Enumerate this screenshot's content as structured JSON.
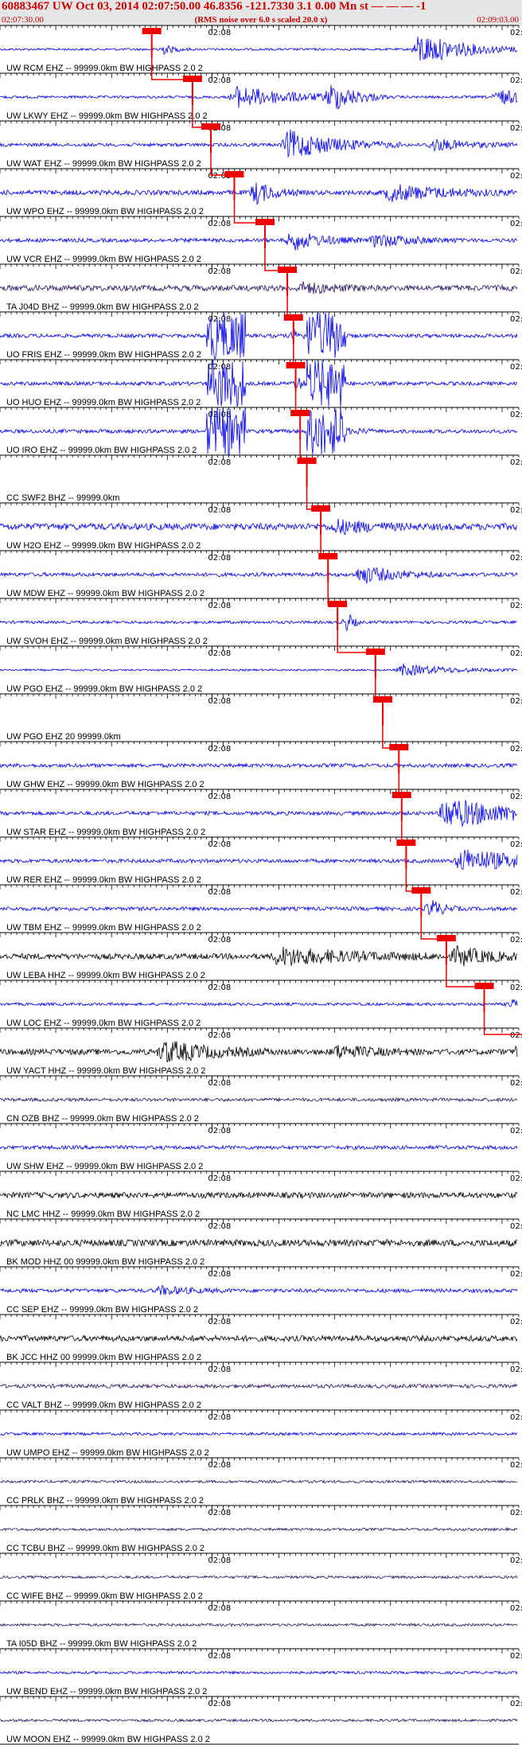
{
  "header": {
    "title": "60883467 UW Oct 03, 2014 02:07:50.00   46.8356 -121.7330  3.1 0.00 Mn st — — —  -1",
    "start_time": "02:07:30.00",
    "note": "(RMS noise over 6.0 s scaled 20.0 x)",
    "end_time": "02:09:03.00"
  },
  "chart_data": {
    "type": "line",
    "title": "60883467 UW Oct 03, 2014 02:07:50.00 46.8356 -121.7330 3.1 0.00 Mn",
    "x_start": "02:07:30.00",
    "x_end": "02:09:03.00",
    "minute_mark": "02:08",
    "minute_mark_end": "02:",
    "colors": {
      "blue": "#0000ee",
      "black": "#000000",
      "purple": "#2a1460",
      "pick": "#ee0000"
    },
    "series": [
      {
        "name": "UW RCM EHZ -- 99999.0km BW  HIGHPASS  2.0  2",
        "color": "blue",
        "pick_s": 27.2,
        "env": [
          [
            48,
            8,
            1.6
          ],
          [
            98,
            3,
            1.0
          ],
          [
            2,
            2,
            0.5
          ]
        ],
        "base": 0.12
      },
      {
        "name": "UW LKWY EHZ -- 99999.0km BW  HIGHPASS  2.0  2",
        "color": "blue",
        "pick_s": 34.5,
        "env": [
          [
            8,
            10,
            1.1
          ],
          [
            25,
            4,
            1.3
          ],
          [
            55,
            8,
            0.7
          ]
        ],
        "base": 0.14
      },
      {
        "name": "UW WAT EHZ -- 99999.0km BW  HIGHPASS  2.0  2",
        "color": "blue",
        "pick_s": 37.8,
        "env": [
          [
            14,
            8,
            1.5
          ],
          [
            40,
            6,
            0.6
          ]
        ],
        "base": 0.18
      },
      {
        "name": "UW WPO EHZ -- 99999.0km BW  HIGHPASS  2.0  2",
        "color": "blue",
        "pick_s": 42.0,
        "env": [
          [
            4,
            3,
            1.1
          ],
          [
            28,
            10,
            0.8
          ],
          [
            55,
            10,
            0.9
          ]
        ],
        "base": 0.25
      },
      {
        "name": "UW VCR EHZ -- 99999.0km BW  HIGHPASS  2.0  2",
        "color": "blue",
        "pick_s": 47.5,
        "env": [
          [
            5,
            5,
            1.0
          ],
          [
            20,
            6,
            0.7
          ]
        ],
        "base": 0.2
      },
      {
        "name": "TA J04D BHZ -- 99999.0km BW  HIGHPASS  2.0  2",
        "color": "purple",
        "pick_s": 51.5,
        "env": [
          [
            88,
            3,
            0.9
          ],
          [
            3,
            5,
            0.5
          ]
        ],
        "base": 0.3
      },
      {
        "name": "UO FRIS EHZ -- 99999.0km BW  HIGHPASS  2.0  2",
        "color": "blue",
        "pick_s": 52.6,
        "env": [
          [
            0.5,
            1,
            0.6
          ]
        ],
        "base": 0.2,
        "clip": [
          [
            37,
            44
          ],
          [
            55,
            62
          ]
        ]
      },
      {
        "name": "UO HUO EHZ -- 99999.0km BW  HIGHPASS  2.0  2",
        "color": "blue",
        "pick_s": 53.0,
        "env": [
          [
            0.5,
            1,
            0.6
          ]
        ],
        "base": 0.2,
        "clip": [
          [
            37,
            44
          ],
          [
            55,
            62
          ]
        ]
      },
      {
        "name": "UO IRO EHZ -- 99999.0km BW  HIGHPASS  2.0  2",
        "color": "blue",
        "pick_s": 53.8,
        "env": [
          [
            3,
            4,
            0.8
          ]
        ],
        "base": 0.2,
        "clip": [
          [
            37,
            44
          ],
          [
            55,
            62
          ]
        ]
      },
      {
        "name": "CC SWF2 BHZ -- 99999.0km",
        "color": "blue",
        "pick_s": 55.0,
        "env": [],
        "base": 0.0
      },
      {
        "name": "UW H2O EHZ -- 99999.0km BW  HIGHPASS  2.0  2",
        "color": "blue",
        "pick_s": 57.5,
        "env": [
          [
            3,
            6,
            0.6
          ]
        ],
        "base": 0.35
      },
      {
        "name": "UW MDW EHZ -- 99999.0km BW  HIGHPASS  2.0  2",
        "color": "blue",
        "pick_s": 58.8,
        "env": [
          [
            6,
            6,
            0.9
          ]
        ],
        "base": 0.2
      },
      {
        "name": "UW SVOH EHZ -- 99999.0km BW  HIGHPASS  2.0  2",
        "color": "blue",
        "pick_s": 60.5,
        "env": [
          [
            2,
            1,
            0.9
          ],
          [
            60,
            1,
            0.6
          ]
        ],
        "base": 0.15
      },
      {
        "name": "UW PGO EHZ -- 99999.0km BW  HIGHPASS  2.0  2",
        "color": "blue",
        "pick_s": 67.3,
        "env": [
          [
            5,
            8,
            0.6
          ]
        ],
        "base": 0.1
      },
      {
        "name": "UW PGO EHZ 20 99999.0km",
        "color": "blue",
        "pick_s": 68.6,
        "env": [],
        "base": 0.0
      },
      {
        "name": "UW GHW EHZ -- 99999.0km BW  HIGHPASS  2.0  2",
        "color": "blue",
        "pick_s": 71.5,
        "env": [
          [
            44,
            2,
            0.9
          ]
        ],
        "base": 0.2
      },
      {
        "name": "UW STAR EHZ -- 99999.0km BW  HIGHPASS  2.0  2",
        "color": "blue",
        "pick_s": 72.0,
        "env": [
          [
            8,
            12,
            1.6
          ]
        ],
        "base": 0.2
      },
      {
        "name": "UW RER EHZ -- 99999.0km BW  HIGHPASS  2.0  2",
        "color": "blue",
        "pick_s": 72.8,
        "env": [
          [
            10,
            12,
            1.2
          ]
        ],
        "base": 0.2
      },
      {
        "name": "UW TBM EHZ -- 99999.0km BW  HIGHPASS  2.0  2",
        "color": "blue",
        "pick_s": 75.5,
        "env": [
          [
            2,
            2,
            0.9
          ]
        ],
        "base": 0.2
      },
      {
        "name": "UW LEBA HHZ -- 99999.0km BW  HIGHPASS  2.0  2",
        "color": "black",
        "pick_s": 80.0,
        "env": [
          [
            -30,
            12,
            0.9
          ],
          [
            2,
            6,
            0.9
          ],
          [
            22,
            8,
            1.5
          ]
        ],
        "base": 0.3
      },
      {
        "name": "UW LOC EHZ -- 99999.0km BW  HIGHPASS  2.0  2",
        "color": "blue",
        "pick_s": 86.8,
        "env": [
          [
            5,
            5,
            0.4
          ]
        ],
        "base": 0.15
      },
      {
        "name": "UW YACT HHZ -- 99999.0km BW  HIGHPASS  2.0  2",
        "color": "black",
        "pick_s": 95.5,
        "env": [
          [
            -66,
            8,
            1.1
          ],
          [
            -35,
            6,
            0.6
          ],
          [
            -2,
            5,
            1.0
          ],
          [
            40,
            3,
            0.6
          ]
        ],
        "base": 0.3
      },
      {
        "name": "CN OZB BHZ -- 99999.0km BW  HIGHPASS  2.0  2",
        "color": "purple",
        "pick_s": 100.5,
        "env": [],
        "base": 0.18
      },
      {
        "name": "UW SHW EHZ -- 99999.0km BW  HIGHPASS  2.0  2",
        "color": "blue",
        "pick_s": 106.5,
        "env": [
          [
            4,
            6,
            0.7
          ]
        ],
        "base": 0.2
      },
      {
        "name": "NC LMC HHZ -- 99999.0km BW  HIGHPASS  2.0  2",
        "color": "black",
        "pick_s": 110.0,
        "env": [
          [
            -5,
            12,
            0.7
          ],
          [
            3,
            3,
            1.0
          ],
          [
            48,
            3,
            1.2
          ]
        ],
        "base": 0.3
      },
      {
        "name": "BK MOD HHZ 00 99999.0km BW  HIGHPASS  2.0  2",
        "color": "black",
        "pick_s": 128.5,
        "env": [
          [
            -25,
            20,
            0.9
          ],
          [
            6,
            8,
            1.5
          ]
        ],
        "base": 0.35
      },
      {
        "name": "CC SEP EHZ -- 99999.0km BW  HIGHPASS  2.0  2",
        "color": "blue",
        "pick_s": 134.0,
        "env": [
          [
            -105,
            5,
            0.4
          ]
        ],
        "base": 0.2
      },
      {
        "name": "BK JCC HHZ 00 99999.0km BW  HIGHPASS  2.0  2",
        "color": "black",
        "pick_s": 139.5,
        "env": [
          [
            0,
            6,
            1.6
          ],
          [
            20,
            4,
            1.6
          ]
        ],
        "base": 0.3
      },
      {
        "name": "CC VALT BHZ -- 99999.0km BW  HIGHPASS  2.0  2",
        "color": "purple",
        "pick_s": 140.5,
        "env": [],
        "base": 0.2
      },
      {
        "name": "UW UMPO EHZ -- 99999.0km BW  HIGHPASS  2.0  2",
        "color": "blue",
        "pick_s": 157.5,
        "env": [],
        "base": 0.15
      },
      {
        "name": "CC PRLK BHZ -- 99999.0km BW  HIGHPASS  2.0  2",
        "color": "purple",
        "pick_s": null,
        "env": [],
        "base": 0.14
      },
      {
        "name": "CC TCBU BHZ -- 99999.0km BW  HIGHPASS  2.0  2",
        "color": "purple",
        "pick_s": null,
        "env": [],
        "base": 0.14
      },
      {
        "name": "CC WIFE BHZ -- 99999.0km BW  HIGHPASS  2.0  2",
        "color": "purple",
        "pick_s": null,
        "env": [],
        "base": 0.14
      },
      {
        "name": "TA I05D BHZ -- 99999.0km BW  HIGHPASS  2.0  2",
        "color": "purple",
        "pick_s": null,
        "env": [],
        "base": 0.14
      },
      {
        "name": "UW BEND EHZ -- 99999.0km BW  HIGHPASS  2.0  2",
        "color": "blue",
        "pick_s": null,
        "env": [],
        "base": 0.14
      },
      {
        "name": "UW MOON EHZ -- 99999.0km BW  HIGHPASS  2.0  2",
        "color": "purple",
        "pick_s": null,
        "env": [],
        "base": 0.14
      }
    ]
  }
}
